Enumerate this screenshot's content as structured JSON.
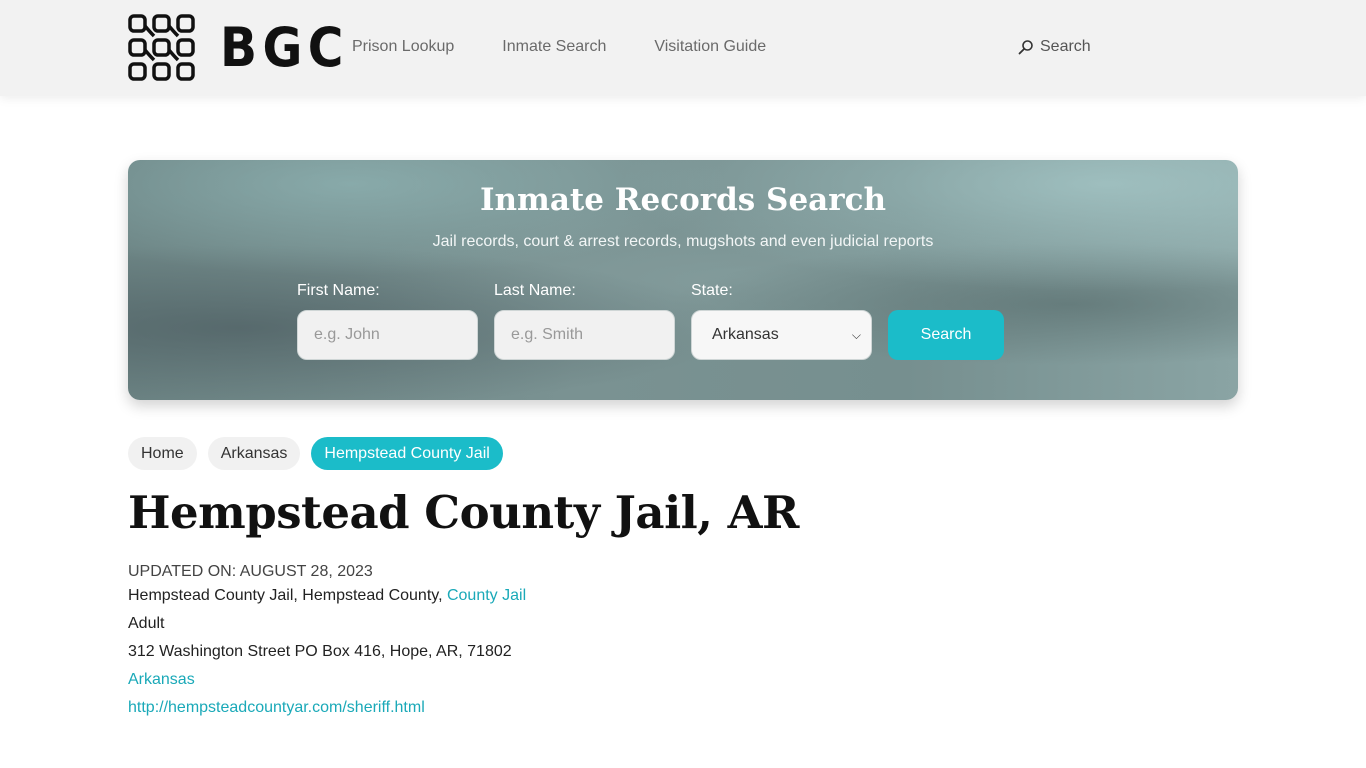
{
  "header": {
    "logo_text": "BGC",
    "nav": [
      {
        "label": "Prison Lookup"
      },
      {
        "label": "Inmate Search"
      },
      {
        "label": "Visitation Guide"
      }
    ],
    "search_label": "Search"
  },
  "hero": {
    "title": "Inmate Records Search",
    "subtitle": "Jail records, court & arrest records, mugshots and even judicial reports",
    "first_name": {
      "label": "First Name:",
      "placeholder": "e.g. John"
    },
    "last_name": {
      "label": "Last Name:",
      "placeholder": "e.g. Smith"
    },
    "state": {
      "label": "State:",
      "selected": "Arkansas"
    },
    "button_label": "Search"
  },
  "breadcrumb": [
    {
      "label": "Home"
    },
    {
      "label": "Arkansas"
    },
    {
      "label": "Hempstead County Jail"
    }
  ],
  "page": {
    "title": "Hempstead County Jail, AR",
    "updated": "UPDATED ON: AUGUST 28, 2023",
    "facility_text": "Hempstead County Jail, Hempstead County, ",
    "facility_type_link": "County Jail",
    "population": "Adult",
    "address": "312 Washington Street PO Box 416, Hope, AR, 71802",
    "state_link": "Arkansas",
    "website_link": "http://hempsteadcountyar.com/sheriff.html"
  },
  "colors": {
    "accent": "#1bbcc9",
    "link": "#1aa9b8"
  },
  "icons": {
    "logo": "bgc-grid-logo",
    "search": "search-icon"
  }
}
